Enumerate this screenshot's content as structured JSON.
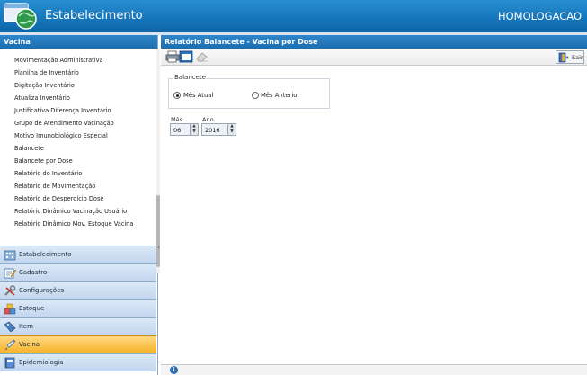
{
  "app": {
    "title": "Estabelecimento",
    "environment": "HOMOLOGACAO",
    "logo_icon": "globe-window-icon"
  },
  "sidebar": {
    "title": "Vacina",
    "items": [
      "Movimentação Administrativa",
      "Planilha de Inventário",
      "Digitação Inventário",
      "Atualiza Inventário",
      "Justificativa Diferença Inventário",
      "Grupo de Atendimento Vacinação",
      "Motivo Imunobiológico Especial",
      "Balancete",
      "Balancete por Dose",
      "Relatório do Inventário",
      "Relatório de Movimentação",
      "Relatório de Desperdício Dose",
      "Relatório Dinâmico Vacinação Usuário",
      "Relatório Dinâmico Mov. Estoque Vacina"
    ],
    "sections": [
      {
        "label": "Estabelecimento",
        "icon": "building-icon",
        "active": false
      },
      {
        "label": "Cadastro",
        "icon": "edit-form-icon",
        "active": false
      },
      {
        "label": "Configurações",
        "icon": "tools-icon",
        "active": false
      },
      {
        "label": "Estoque",
        "icon": "boxes-icon",
        "active": false
      },
      {
        "label": "Item",
        "icon": "tag-icon",
        "active": false
      },
      {
        "label": "Vacina",
        "icon": "syringe-icon",
        "active": true
      },
      {
        "label": "Epidemiologia",
        "icon": "book-icon",
        "active": false
      }
    ]
  },
  "main": {
    "title": "Relatório Balancete - Vacina por Dose",
    "toolbar": {
      "print_icon": "print-icon",
      "erase_icon": "eraser-icon",
      "exit_label": "Sair",
      "exit_icon": "exit-door-icon"
    },
    "form": {
      "group_label": "Balancete",
      "options": [
        {
          "label": "Mês Atual",
          "checked": true
        },
        {
          "label": "Mês Anterior",
          "checked": false
        }
      ],
      "month_label": "Mês",
      "month_value": "06",
      "year_label": "Ano",
      "year_value": "2016"
    },
    "status_icon": "info-icon"
  },
  "colors": {
    "header_blue": "#1677bd",
    "active_section": "#f7b226",
    "section_blue": "#c1d6ef"
  }
}
